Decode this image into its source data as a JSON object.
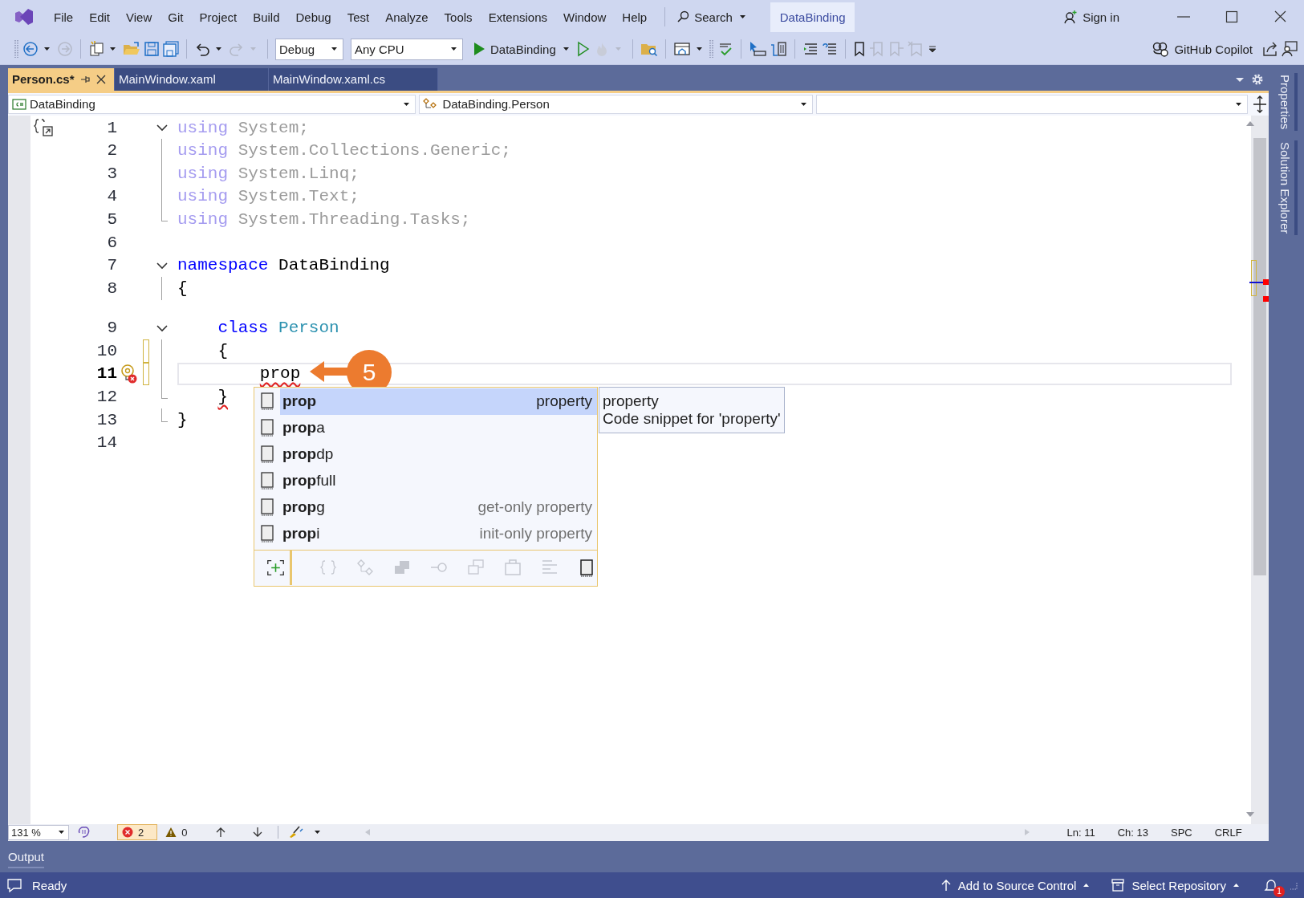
{
  "title_bar": {
    "menu": [
      {
        "label": "File"
      },
      {
        "label": "Edit"
      },
      {
        "label": "View"
      },
      {
        "label": "Git"
      },
      {
        "label": "Project"
      },
      {
        "label": "Build"
      },
      {
        "label": "Debug"
      },
      {
        "label": "Test"
      },
      {
        "label": "Analyze"
      },
      {
        "label": "Tools"
      },
      {
        "label": "Extensions"
      },
      {
        "label": "Window"
      },
      {
        "label": "Help"
      }
    ],
    "search": "Search",
    "solution": "DataBinding",
    "sign_in": "Sign in"
  },
  "toolbar": {
    "configuration": "Debug",
    "platform": "Any CPU",
    "start": "DataBinding",
    "copilot": "GitHub Copilot"
  },
  "tabs": [
    {
      "label": "Person.cs*",
      "selected": true
    },
    {
      "label": "MainWindow.xaml",
      "selected": false
    },
    {
      "label": "MainWindow.xaml.cs",
      "selected": false
    }
  ],
  "navigation": {
    "project": "DataBinding",
    "type": "DataBinding.Person"
  },
  "code": {
    "lines": [
      {
        "number": "1",
        "collapsible": true,
        "outline": false,
        "outline_end": false,
        "faded": true,
        "current": false,
        "modified": false,
        "tokens": [
          {
            "text": "using",
            "kind": "keyword"
          },
          {
            "text": " System;",
            "kind": "plain"
          }
        ]
      },
      {
        "number": "2",
        "collapsible": false,
        "outline": true,
        "outline_end": false,
        "faded": true,
        "current": false,
        "modified": false,
        "tokens": [
          {
            "text": "using",
            "kind": "keyword"
          },
          {
            "text": " System.Collections.Generic;",
            "kind": "plain"
          }
        ]
      },
      {
        "number": "3",
        "collapsible": false,
        "outline": true,
        "outline_end": false,
        "faded": true,
        "current": false,
        "modified": false,
        "tokens": [
          {
            "text": "using",
            "kind": "keyword"
          },
          {
            "text": " System.Linq;",
            "kind": "plain"
          }
        ]
      },
      {
        "number": "4",
        "collapsible": false,
        "outline": true,
        "outline_end": false,
        "faded": true,
        "current": false,
        "modified": false,
        "tokens": [
          {
            "text": "using",
            "kind": "keyword"
          },
          {
            "text": " System.Text;",
            "kind": "plain"
          }
        ]
      },
      {
        "number": "5",
        "collapsible": false,
        "outline": false,
        "outline_end": true,
        "faded": true,
        "current": false,
        "modified": false,
        "tokens": [
          {
            "text": "using",
            "kind": "keyword"
          },
          {
            "text": " System.Threading.Tasks;",
            "kind": "plain"
          }
        ]
      },
      {
        "number": "6",
        "collapsible": false,
        "outline": false,
        "outline_end": false,
        "current": false,
        "modified": false
      },
      {
        "number": "7",
        "collapsible": true,
        "outline": false,
        "outline_end": false,
        "faded": false,
        "current": false,
        "modified": false,
        "tokens": [
          {
            "text": "namespace",
            "kind": "keyword"
          },
          {
            "text": " DataBinding",
            "kind": "plain"
          }
        ]
      },
      {
        "number": "8",
        "collapsible": false,
        "outline": true,
        "outline_end": false,
        "faded": false,
        "current": false,
        "modified": false,
        "tokens": [
          {
            "text": "{",
            "kind": "plain"
          }
        ]
      },
      {
        "number": "9",
        "collapsible": true,
        "outline": false,
        "outline_end": false,
        "faded": false,
        "current": false,
        "modified": false,
        "tokens": [
          {
            "text": "    class",
            "kind": "keyword"
          },
          {
            "text": " Person",
            "kind": "type"
          }
        ]
      },
      {
        "number": "10",
        "collapsible": false,
        "outline": true,
        "outline_end": false,
        "faded": false,
        "current": false,
        "modified": true,
        "tokens": [
          {
            "text": "    {",
            "kind": "plain"
          }
        ]
      },
      {
        "number": "11",
        "collapsible": false,
        "outline": true,
        "outline_end": false,
        "faded": false,
        "current": true,
        "modified": true,
        "tokens": [
          {
            "text": "        prop",
            "kind": "error"
          }
        ]
      },
      {
        "number": "12",
        "collapsible": false,
        "outline": false,
        "outline_end": true,
        "faded": false,
        "current": false,
        "modified": false,
        "tokens": [
          {
            "text": "    }",
            "kind": "error"
          }
        ]
      },
      {
        "number": "13",
        "collapsible": false,
        "outline": false,
        "outline_end": true,
        "faded": false,
        "current": false,
        "modified": false,
        "tokens": [
          {
            "text": "}",
            "kind": "plain"
          }
        ]
      },
      {
        "number": "14",
        "collapsible": false,
        "outline": false,
        "outline_end": false,
        "current": false,
        "modified": false
      }
    ]
  },
  "callout": {
    "label": "5"
  },
  "completion": {
    "items": [
      {
        "match": "prop",
        "description": "property",
        "selected": true
      },
      {
        "match": "prop",
        "rest": "a",
        "selected": false
      },
      {
        "match": "prop",
        "rest": "dp",
        "selected": false
      },
      {
        "match": "prop",
        "rest": "full",
        "selected": false
      },
      {
        "match": "prop",
        "rest": "g",
        "description": "get-only property",
        "selected": false
      },
      {
        "match": "prop",
        "rest": "i",
        "description": "init-only property",
        "selected": false
      }
    ],
    "filters": [
      {
        "kind": "namespace",
        "active": false
      },
      {
        "kind": "class",
        "active": false
      },
      {
        "kind": "structure",
        "active": false
      },
      {
        "kind": "interface",
        "active": false
      },
      {
        "kind": "enum",
        "active": false
      },
      {
        "kind": "module",
        "active": false
      },
      {
        "kind": "keyword",
        "active": false
      },
      {
        "kind": "snippet",
        "active": true
      }
    ],
    "tooltip": {
      "title": "property",
      "description": "Code snippet for 'property'"
    }
  },
  "editor_status": {
    "zoom": "131 %",
    "errors": "2",
    "warnings": "0",
    "line": "Ln: 11",
    "column": "Ch: 13",
    "whitespace": "SPC",
    "line_ending": "CRLF"
  },
  "side_tabs": [
    {
      "label": "Properties"
    },
    {
      "label": "Solution Explorer"
    }
  ],
  "output_panel": {
    "title": "Output"
  },
  "status_bar": {
    "state": "Ready",
    "source_control": "Add to Source Control",
    "repository": "Select Repository",
    "notifications": "1"
  }
}
